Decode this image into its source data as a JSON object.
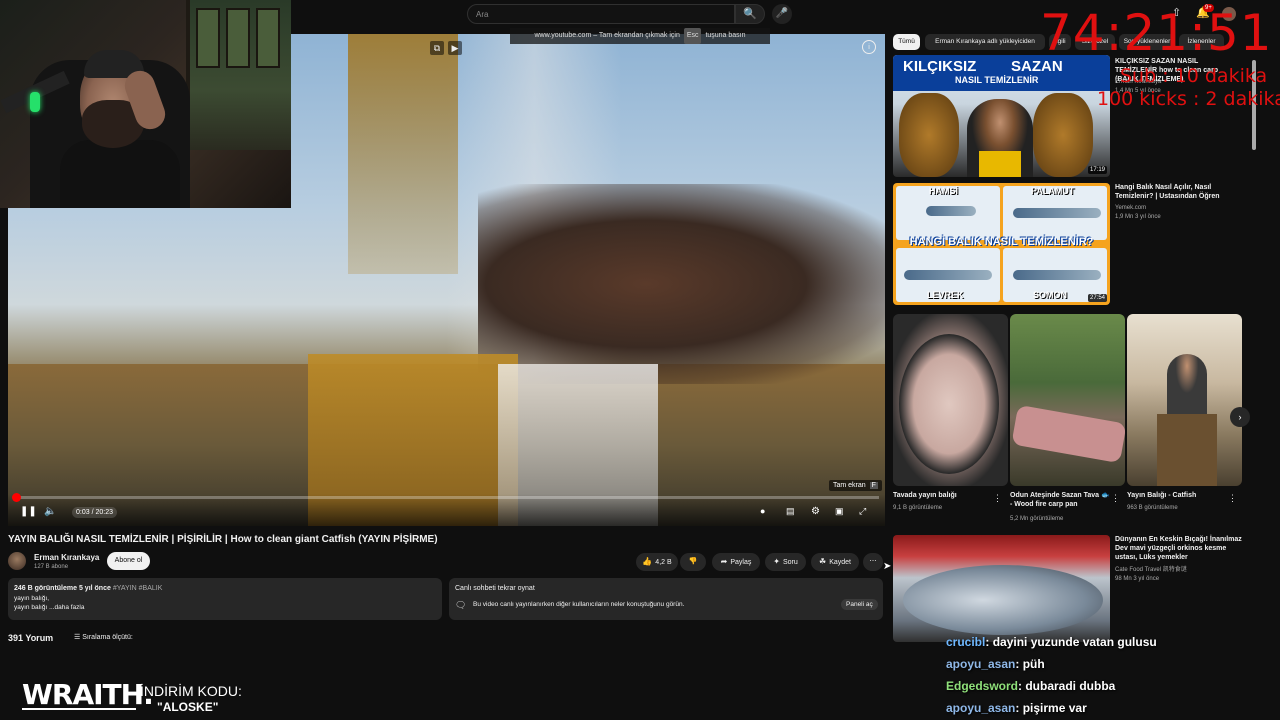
{
  "header": {
    "search_placeholder": "Ara",
    "notif_count": "9+"
  },
  "overlay": {
    "tooltip_prefix": "www.youtube.com – Tam ekrandan çıkmak için",
    "tooltip_key": "Esc",
    "tooltip_suffix": "tuşuna basın",
    "fullscreen_label": "Tam ekran",
    "fullscreen_key": "F"
  },
  "player": {
    "time": "0:03 / 20:23",
    "progress_fraction": 0.0025
  },
  "video": {
    "title": "YAYIN BALIĞI NASIL TEMİZLENİR | PİŞİRİLİR | How to clean giant Catfish (YAYIN PİŞİRME)",
    "channel": "Erman Kırankaya",
    "subscribers": "127 B abone",
    "subscribe": "Abone ol",
    "likes": "4,2 B",
    "share": "Paylaş",
    "ask": "Soru",
    "save": "Kaydet"
  },
  "description": {
    "views": "246 B görüntüleme  5 yıl önce",
    "tags": "#YAYIN #BALIK",
    "line1": "yayın balığı,",
    "line2_a": "yayın balığı",
    "line2_b": "...daha fazla"
  },
  "live_chat": {
    "title": "Canlı sohbeti tekrar oynat",
    "desc": "Bu video canlı yayınlanırken diğer kullanıcıların neler konuştuğunu görün.",
    "open": "Paneli aç"
  },
  "comments": {
    "count": "391 Yorum",
    "sort": "Sıralama ölçütü:"
  },
  "sponsor": {
    "brand": "WRAITH.",
    "promo_label": "İNDİRİM KODU:",
    "promo_code": "\"ALOSKE\""
  },
  "chips": [
    "Tümü",
    "Erman Kırankaya adlı yükleyiciden",
    "İlgili",
    "Size özel",
    "Son yüklenenler",
    "İzlenenler"
  ],
  "sidebar": {
    "videos": [
      {
        "title": "KILÇIKSIZ SAZAN NASIL TEMİZLENİR how to clean carp (BALIK TEMİZLEME)",
        "channel": "Erman Kırankaya",
        "meta": "1,4 Mn  5 yıl önce",
        "duration": "17:19",
        "thumb_text1": "KILÇIKSIZ",
        "thumb_text2": "SAZAN",
        "thumb_text3": "NASIL TEMİZLENİR"
      },
      {
        "title": "Hangi Balık Nasıl Açılır, Nasıl Temizlenir? | Ustasından Öğren",
        "channel": "Yemek.com",
        "meta": "1,9 Mn  3 yıl önce",
        "duration": "27:54",
        "thumb_labels": [
          "HAMSİ",
          "PALAMUT",
          "LEVREK",
          "SOMON"
        ],
        "thumb_mid": "HANGİ BALIK NASIL TEMİZLENİR?"
      },
      {
        "title": "Dünyanın En Keskin Bıçağı!  İnanılmaz Dev mavi yüzgeçli orkinos kesme ustası, Lüks yemekler",
        "channel": "Cate Food Travel 凯特食谜",
        "meta": "98 Mn  3 yıl önce"
      }
    ],
    "shorts": [
      {
        "title": "Tavada yayın balığı",
        "views": "9,1 B görüntüleme"
      },
      {
        "title": "Odun Ateşinde Sazan Tava 🐟 - Wood fire carp pan",
        "views": "5,2 Mn görüntüleme"
      },
      {
        "title": "Yayın Balığı - Catfish",
        "views": "963 B görüntüleme"
      }
    ]
  },
  "chat": [
    {
      "user": "crucibl",
      "msg": ": dayini yuzunde vatan gulusu",
      "color": "#6fb8ff"
    },
    {
      "user": "apoyu_asan",
      "msg": ": püh",
      "color": "#8fb8e8"
    },
    {
      "user": "Edgedsword",
      "msg": ": dubaradi dubba",
      "color": "#8fe07a"
    },
    {
      "user": "apoyu_asan",
      "msg": ": pişirme var",
      "color": "#8fb8e8"
    }
  ],
  "timer": {
    "clock": "74:21:51",
    "line1": "Sub : 10 dakika",
    "line2": "100 kicks : 2 dakika"
  },
  "colors": {
    "accent": "#ff0000",
    "timer": "#e01010",
    "background": "#0f0f0f"
  }
}
